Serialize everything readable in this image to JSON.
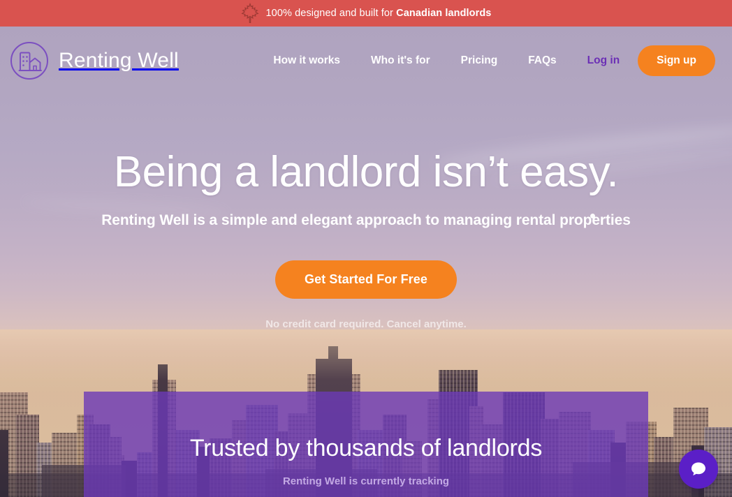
{
  "announcement": {
    "icon": "maple-leaf-icon",
    "text_plain": "100% designed and built for ",
    "text_bold": "Canadian landlords",
    "background_color": "#d9534f",
    "text_color": "#ffffff"
  },
  "header": {
    "logo_icon": "building-house-circle-logo-icon",
    "brand_name": "Renting Well",
    "nav": [
      {
        "label": "How it works",
        "name": "nav-how-it-works"
      },
      {
        "label": "Who it's for",
        "name": "nav-who-its-for"
      },
      {
        "label": "Pricing",
        "name": "nav-pricing"
      },
      {
        "label": "FAQs",
        "name": "nav-faqs"
      }
    ],
    "login_label": "Log in",
    "login_color": "#6b2fb5",
    "signup_label": "Sign up",
    "signup_color": "#f5821f"
  },
  "hero": {
    "title": "Being a landlord isn’t easy.",
    "subtitle": "Renting Well is a simple and elegant approach to managing rental properties",
    "cta_label": "Get Started For Free",
    "cta_color": "#f5821f",
    "note": "No credit card required. Cancel anytime."
  },
  "trusted": {
    "title": "Trusted by thousands of landlords",
    "subtitle": "Renting Well is currently tracking",
    "panel_color": "#6c3ab7",
    "subtitle_color": "#c3a9e4"
  },
  "chat": {
    "icon": "chat-bubble-icon",
    "color": "#5b1fc7"
  }
}
